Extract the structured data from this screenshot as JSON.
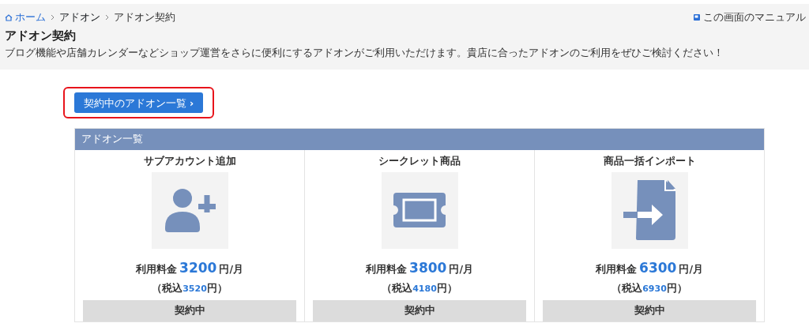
{
  "breadcrumb": [
    {
      "label": "ホーム",
      "kind": "home"
    },
    {
      "label": "アドオン",
      "kind": "link"
    },
    {
      "label": "アドオン契約",
      "kind": "current"
    }
  ],
  "manual_link": "この画面のマニュアル",
  "page_title": "アドオン契約",
  "description": "ブログ機能や店舗カレンダーなどショップ運営をさらに便利にするアドオンがご利用いただけます。貴店に合ったアドオンのご利用をぜひご検討ください！",
  "contracted_button": {
    "label": "契約中のアドオン一覧",
    "chevron": "›",
    "highlighted": true
  },
  "addon_panel": {
    "title": "アドオン一覧",
    "addons": [
      {
        "name": "サブアカウント追加",
        "kind": "user-plus",
        "price_label": "利用料金",
        "price": "3200",
        "price_unit": "円/月",
        "tax_prefix": "（税込",
        "tax_price": "3520",
        "tax_suffix": "円）",
        "status": "契約中"
      },
      {
        "name": "シークレット商品",
        "kind": "ticket",
        "price_label": "利用料金",
        "price": "3800",
        "price_unit": "円/月",
        "tax_prefix": "（税込",
        "tax_price": "4180",
        "tax_suffix": "円）",
        "status": "契約中"
      },
      {
        "name": "商品一括インポート",
        "kind": "file-import",
        "price_label": "利用料金",
        "price": "6300",
        "price_unit": "円/月",
        "tax_prefix": "（税込",
        "tax_price": "6930",
        "tax_suffix": "円）",
        "status": "契約中"
      }
    ]
  }
}
